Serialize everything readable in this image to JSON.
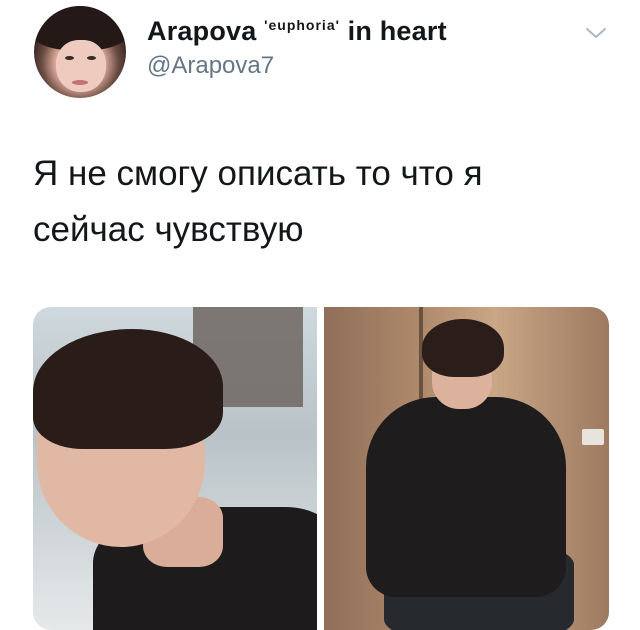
{
  "tweet": {
    "author": {
      "name": "Arapova",
      "name_superscript": "'euphoria'",
      "name_suffix": "in heart",
      "handle": "@Arapova7",
      "avatar_icon": "profile-photo"
    },
    "menu_icon": "chevron-down-icon",
    "text_lines": [
      "Я не смогу описать то что я",
      "сейчас чувствую"
    ],
    "media": [
      {
        "icon": "photo",
        "description_icon": "image-thumbnail"
      },
      {
        "icon": "photo",
        "description_icon": "image-thumbnail"
      }
    ]
  },
  "colors": {
    "text": "#14171a",
    "secondary_text": "#657786",
    "background": "#ffffff"
  }
}
